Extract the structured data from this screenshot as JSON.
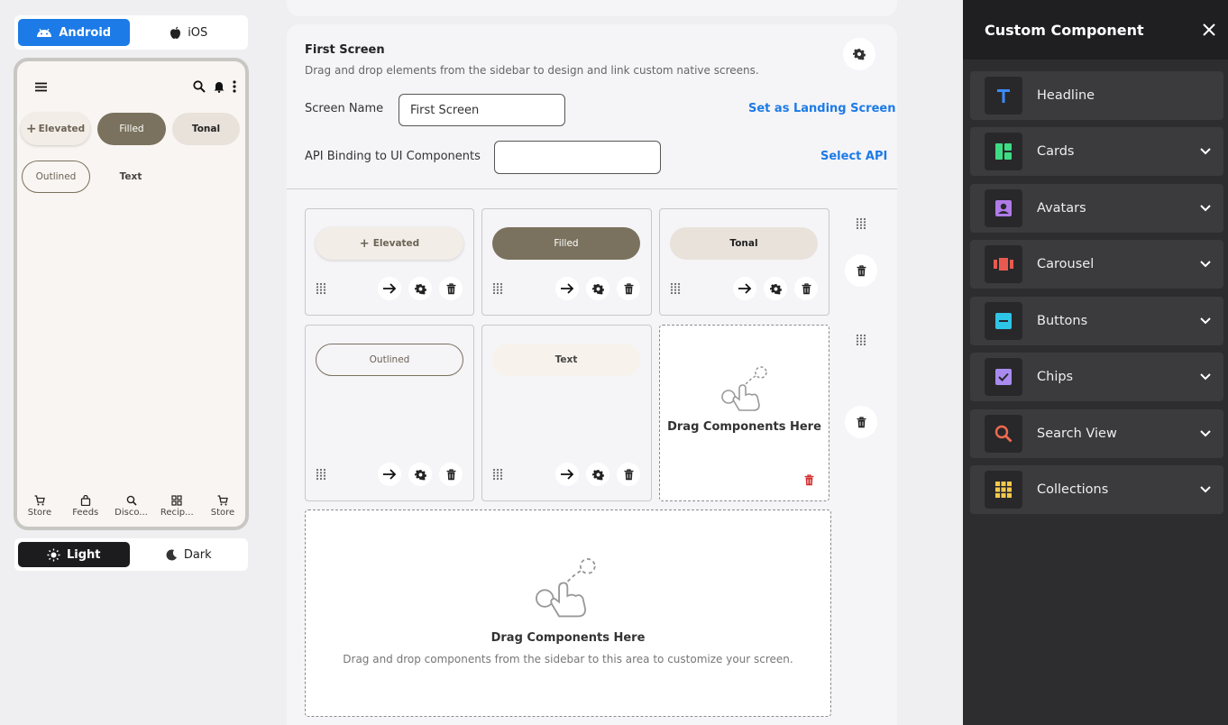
{
  "platform_toggle": {
    "android": "Android",
    "ios": "iOS"
  },
  "phone_preview": {
    "buttons": {
      "elevated": "Elevated",
      "filled": "Filled",
      "tonal": "Tonal",
      "outlined": "Outlined",
      "text": "Text"
    },
    "bottom_nav": [
      "Store",
      "Feeds",
      "Disco...",
      "Recip...",
      "Store"
    ]
  },
  "theme_toggle": {
    "light": "Light",
    "dark": "Dark"
  },
  "screen": {
    "title": "First Screen",
    "subtitle": "Drag and drop elements from the sidebar to design and link custom native screens.",
    "name_label": "Screen Name",
    "name_value": "First Screen",
    "landing_link": "Set as Landing Screen",
    "api_label": "API Binding to UI Components",
    "api_value": "",
    "select_api": "Select API"
  },
  "grid": {
    "cells": [
      {
        "label": "Elevated"
      },
      {
        "label": "Filled"
      },
      {
        "label": "Tonal"
      },
      {
        "label": "Outlined"
      },
      {
        "label": "Text"
      }
    ],
    "cell_drop_title": "Drag Components Here",
    "main_drop_title": "Drag Components Here",
    "main_drop_sub": "Drag and drop components from the sidebar to this area to customize your screen."
  },
  "panel": {
    "title": "Custom Component",
    "items": [
      {
        "label": "Headline",
        "icon": "headline-icon",
        "color": "#3d8bfd"
      },
      {
        "label": "Cards",
        "icon": "cards-icon",
        "color": "#3ddc84"
      },
      {
        "label": "Avatars",
        "icon": "avatar-icon",
        "color": "#b07ae8"
      },
      {
        "label": "Carousel",
        "icon": "carousel-icon",
        "color": "#e85a4f"
      },
      {
        "label": "Buttons",
        "icon": "buttons-icon",
        "color": "#2ec5e6"
      },
      {
        "label": "Chips",
        "icon": "chips-icon",
        "color": "#a98bf0"
      },
      {
        "label": "Search View",
        "icon": "search-icon",
        "color": "#f06a4f"
      },
      {
        "label": "Collections",
        "icon": "collections-icon",
        "color": "#f2c94c"
      }
    ]
  },
  "colors": {
    "accent": "#1c7be6",
    "filled": "#7a725e",
    "tonal": "#e8e2db",
    "delete": "#d32f2f",
    "panel": "#2d2d30"
  }
}
